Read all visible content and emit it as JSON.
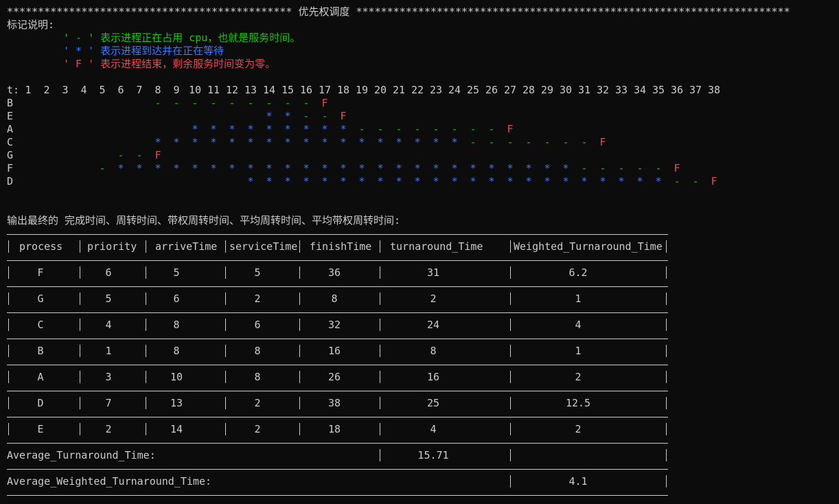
{
  "header": {
    "stars_left": "**********************************************",
    "title": "优先权调度",
    "stars_right": "**********************************************************************"
  },
  "legend": {
    "heading": "标记说明:",
    "run": "' - ' 表示进程正在占用 cpu，也就是服务时间。",
    "wait": "' * ' 表示进程到达并在正在等待",
    "finish": "' F ' 表示进程结束，剩余服务时间变为零。"
  },
  "gantt": {
    "t_label": "t:",
    "ticks": [
      "1",
      "2",
      "3",
      "4",
      "5",
      "6",
      "7",
      "8",
      "9",
      "10",
      "11",
      "12",
      "13",
      "14",
      "15",
      "16",
      "17",
      "18",
      "19",
      "20",
      "21",
      "22",
      "23",
      "24",
      "25",
      "26",
      "27",
      "28",
      "29",
      "30",
      "31",
      "32",
      "33",
      "34",
      "35",
      "36",
      "37",
      "38"
    ],
    "rows": [
      {
        "name": "B",
        "marks": "       ---------F"
      },
      {
        "name": "E",
        "marks": "             **--F"
      },
      {
        "name": "A",
        "marks": "         *********--------F"
      },
      {
        "name": "C",
        "marks": "       *****************-------F"
      },
      {
        "name": "G",
        "marks": "     --F"
      },
      {
        "name": "F",
        "marks": "    -*************************-----F"
      },
      {
        "name": "D",
        "marks": "            ***********************--F"
      }
    ]
  },
  "table_caption": "输出最终的 完成时间、周转时间、带权周转时间、平均周转时间、平均带权周转时间:",
  "table": {
    "headers": [
      "process",
      "priority",
      "arriveTime",
      "serviceTime",
      "finishTime",
      "turnaround_Time",
      "Weighted_Turnaround_Time"
    ],
    "rows": [
      [
        "F",
        "6",
        "5",
        "5",
        "36",
        "31",
        "6.2"
      ],
      [
        "G",
        "5",
        "6",
        "2",
        "8",
        "2",
        "1"
      ],
      [
        "C",
        "4",
        "8",
        "6",
        "32",
        "24",
        "4"
      ],
      [
        "B",
        "1",
        "8",
        "8",
        "16",
        "8",
        "1"
      ],
      [
        "A",
        "3",
        "10",
        "8",
        "26",
        "16",
        "2"
      ],
      [
        "D",
        "7",
        "13",
        "2",
        "38",
        "25",
        "12.5"
      ],
      [
        "E",
        "2",
        "14",
        "2",
        "18",
        "4",
        "2"
      ]
    ],
    "avg_turnaround_label": "Average_Turnaround_Time:",
    "avg_turnaround_value": "15.71",
    "avg_weighted_label": "Average_Weighted_Turnaround_Time:",
    "avg_weighted_value": "4.1"
  },
  "colors": {
    "background": "#0c0c0c",
    "text": "#cccccc",
    "run": "#16c60c",
    "wait": "#3b78ff",
    "finish": "#e74856"
  }
}
